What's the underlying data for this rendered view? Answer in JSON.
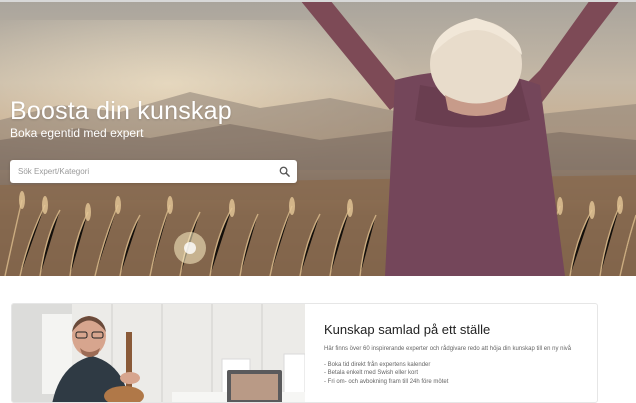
{
  "hero": {
    "title": "Boosta din kunskap",
    "subtitle": "Boka egentid med expert"
  },
  "search": {
    "placeholder": "Sök Expert/Kategori",
    "icon": "search-icon"
  },
  "feature": {
    "title": "Kunskap samlad på ett ställe",
    "description": "Här finns över 60 inspirerande experter och rådgivare redo att höja din kunskap till en ny nivå",
    "bullets": [
      "- Boka tid direkt från expertens kalender",
      "- Betala enkelt med Swish eller kort",
      "- Fri om- och avbokning fram till 24h före mötet"
    ]
  },
  "colors": {
    "hero_text": "#ffffff",
    "card_title": "#222222",
    "card_text": "#666666"
  }
}
